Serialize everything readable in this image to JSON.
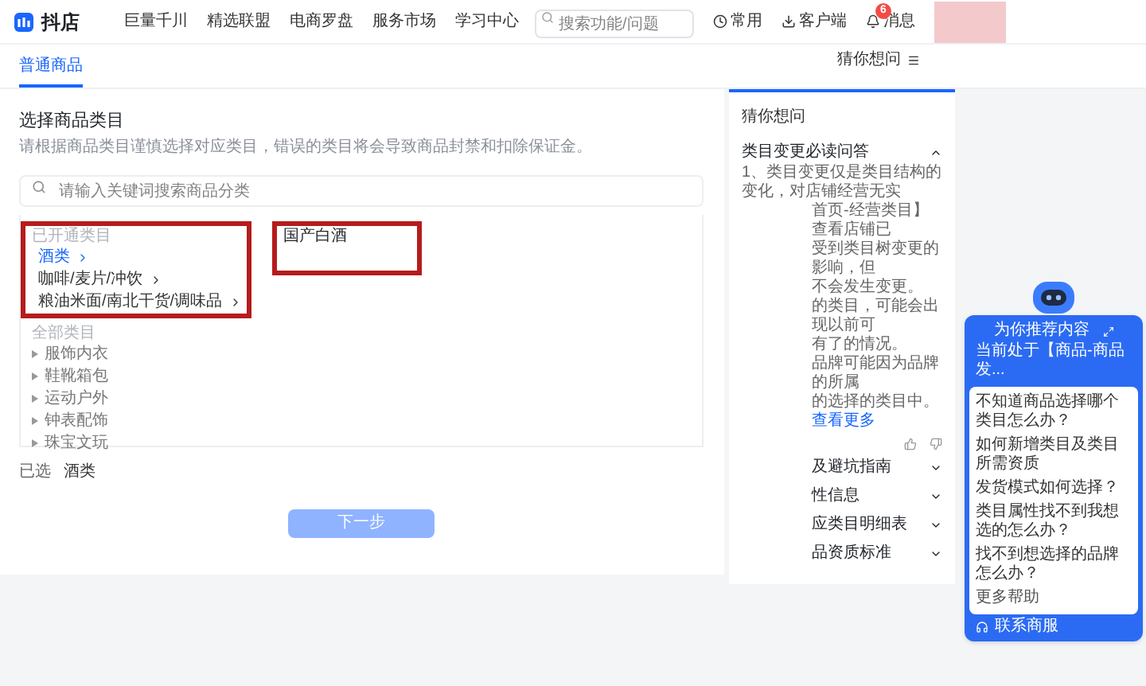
{
  "header": {
    "logo": "抖店",
    "nav": [
      "巨量千川",
      "精选联盟",
      "电商罗盘",
      "服务市场",
      "学习中心"
    ],
    "search": {
      "placeholder": "搜索功能/问题"
    },
    "actions": [
      {
        "label": "常用",
        "kind": "clock"
      },
      {
        "label": "客户端",
        "kind": "download"
      },
      {
        "label": "消息",
        "kind": "bell",
        "badge": "6"
      }
    ]
  },
  "tabs": [
    {
      "label": "普通商品",
      "selected": true
    }
  ],
  "help_toggle": "猜你想问",
  "category": {
    "title": "选择商品类目",
    "description": "请根据商品类目谨慎选择对应类目，错误的类目将会导致商品封禁和扣除保证金。",
    "search": {
      "placeholder": "请输入关键词搜索商品分类"
    },
    "groups": [
      {
        "heading": "已开通类目",
        "annotated": true,
        "items": [
          {
            "label": "酒类",
            "kind": "expandable",
            "selected": true
          },
          {
            "label": "咖啡/麦片/冲饮",
            "kind": "expandable",
            "selected": false
          },
          {
            "label": "粮油米面/南北干货/调味品",
            "kind": "expandable",
            "selected": false
          }
        ]
      },
      {
        "heading": "全部类目",
        "annotated": false,
        "items": [
          {
            "label": "服饰内衣",
            "kind": "bullet",
            "selected": false
          },
          {
            "label": "鞋靴箱包",
            "kind": "bullet",
            "selected": false
          },
          {
            "label": "运动户外",
            "kind": "bullet",
            "selected": false
          },
          {
            "label": "钟表配饰",
            "kind": "bullet",
            "selected": false
          },
          {
            "label": "珠宝文玩",
            "kind": "bullet",
            "selected": false
          }
        ]
      }
    ],
    "subcategories": {
      "annotated": true,
      "items": [
        {
          "label": "国产白酒",
          "selected": false
        }
      ]
    }
  },
  "selected_summary": {
    "label": "已选",
    "value": "酒类"
  },
  "next_button": {
    "label": "下一步",
    "disabled": true
  },
  "faq": {
    "title": "猜你想问",
    "items": [
      {
        "title": "类目变更必读问答",
        "expanded": true,
        "lines": [
          "1、类目变更仅是类目结构的变化，对店铺经营无实",
          "首页-经营类目】查看店铺已",
          "受到类目树变更的影响，但",
          "不会发生变更。",
          "的类目，可能会出现以前可",
          "有了的情况。",
          "品牌可能因为品牌的所属",
          "的选择的类目中。"
        ],
        "link": "查看更多"
      },
      {
        "title": "及避坑指南",
        "expanded": false
      },
      {
        "title": "性信息",
        "expanded": false
      },
      {
        "title": "应类目明细表",
        "expanded": false
      },
      {
        "title": "品资质标准",
        "expanded": false
      }
    ]
  },
  "assistant": {
    "title": "为你推荐内容",
    "subtitle": "当前处于【商品-商品发...",
    "questions": [
      "不知道商品选择哪个类目怎么办？",
      "如何新增类目及类目所需资质",
      "发货模式如何选择？",
      "类目属性找不到我想选的怎么办？",
      "找不到想选择的品牌怎么办？"
    ],
    "more": "更多帮助",
    "contact": "联系商服"
  }
}
